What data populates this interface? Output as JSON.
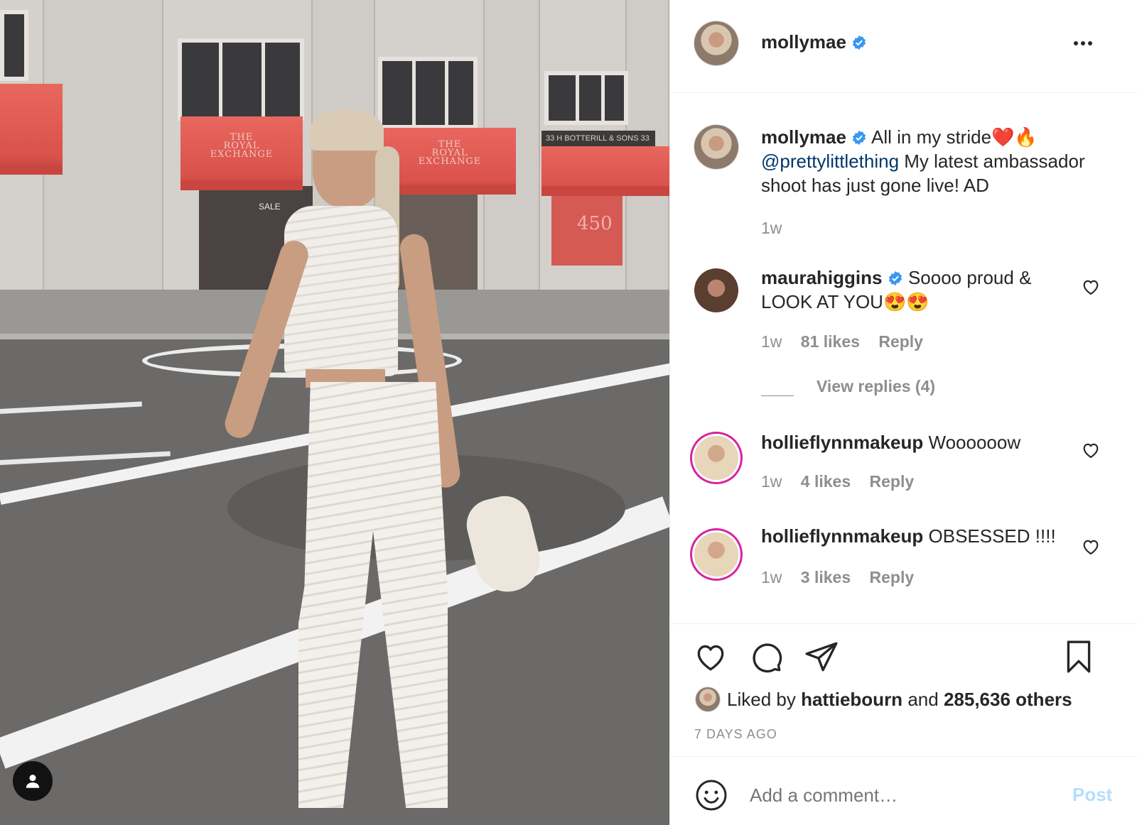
{
  "post": {
    "author": "mollymae",
    "caption_emoji": "❤️🔥",
    "caption_text": "All in my stride",
    "caption_mention": "@prettylittlething",
    "caption_rest": " My latest ambassador shoot has just gone live! AD",
    "caption_age": "1w",
    "liked_by_prefix": "Liked by",
    "liked_by_user": "hattiebourn",
    "liked_by_and": "and",
    "liked_by_others": "285,636 others",
    "posted_ago": "7 DAYS AGO"
  },
  "photo": {
    "awning_text_1": "THE\nROYAL\nEXCHANGE",
    "awning_text_2": "THE\nROYAL\nEXCHANGE",
    "shop_sign": "33 H BOTTERILL & SONS 33",
    "sale_sign": "SALE",
    "number_sign": "450"
  },
  "comments": [
    {
      "user": "maurahiggins",
      "verified": true,
      "text": "Soooo proud & LOOK AT YOU",
      "emoji": "😍😍",
      "age": "1w",
      "likes": "81 likes",
      "reply": "Reply",
      "view_replies": "View replies (4)"
    },
    {
      "user": "hollieflynnmakeup",
      "verified": false,
      "text": "Woooooow",
      "age": "1w",
      "likes": "4 likes",
      "reply": "Reply"
    },
    {
      "user": "hollieflynnmakeup",
      "verified": false,
      "text": "OBSESSED !!!!",
      "age": "1w",
      "likes": "3 likes",
      "reply": "Reply"
    }
  ],
  "composer": {
    "placeholder": "Add a comment…",
    "post_label": "Post"
  },
  "icons": {
    "more": "more-options-icon",
    "like": "heart-icon",
    "comment": "comment-icon",
    "share": "share-icon",
    "save": "bookmark-icon",
    "emoji": "emoji-icon",
    "user": "user-icon"
  },
  "colors": {
    "verified_blue": "#3897f0",
    "link": "#00376b",
    "muted": "#8e8e8e",
    "post_disabled": "#b2dffc"
  }
}
